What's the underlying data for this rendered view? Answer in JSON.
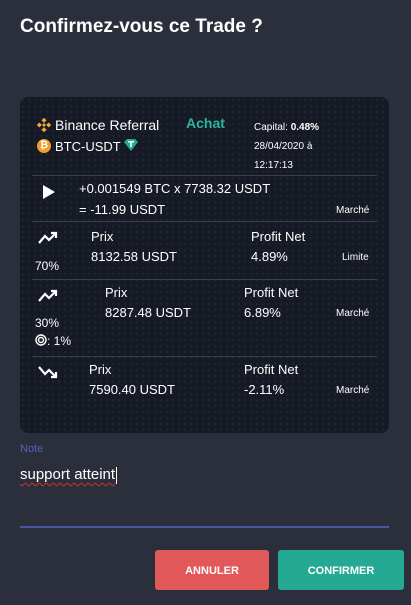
{
  "dialog": {
    "title": "Confirmez-vous ce Trade ?"
  },
  "header": {
    "exchange": "Binance Referral",
    "pair": "BTC-USDT",
    "side": "Achat",
    "capital_label": "Capital:",
    "capital_value": "0.48%",
    "date": "28/04/2020 à",
    "time": "12:17:13"
  },
  "entry": {
    "line1": "+0.001549 BTC x 7738.32 USDT",
    "line2": "= -11.99 USDT",
    "type": "Marché"
  },
  "targets": [
    {
      "pct": "70%",
      "prix_label": "Prix",
      "prix": "8132.58 USDT",
      "profit_label": "Profit Net",
      "profit": "4.89%",
      "type": "Limite"
    },
    {
      "pct": "30%",
      "trail": ": 1%",
      "prix_label": "Prix",
      "prix": "8287.48 USDT",
      "profit_label": "Profit Net",
      "profit": "6.89%",
      "type": "Marché"
    }
  ],
  "stop": {
    "prix_label": "Prix",
    "prix": "7590.40 USDT",
    "profit_label": "Profit Net",
    "profit": "-2.11%",
    "type": "Marché"
  },
  "note": {
    "label": "Note",
    "value": "support atteint"
  },
  "buttons": {
    "cancel": "ANNULER",
    "confirm": "CONFIRMER"
  },
  "colors": {
    "background": "#2b2f3c",
    "card": "#161a24",
    "accent": "#26b5a0",
    "cancel": "#e05858",
    "confirm": "#26a994",
    "note_line": "#4a55a6"
  },
  "icons": [
    "binance-icon",
    "bitcoin-icon",
    "tether-icon",
    "play-icon",
    "trend-up-icon",
    "trailing-icon",
    "trend-down-icon"
  ]
}
